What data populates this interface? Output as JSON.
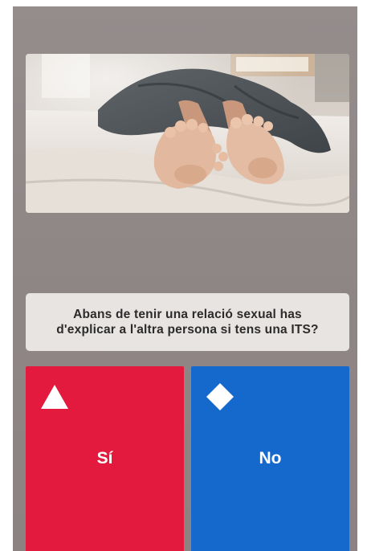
{
  "question": {
    "line1": "Abans de tenir una relació sexual has",
    "line2": "d'explicar a l'altra persona si tens una ITS?"
  },
  "image": {
    "subject": "feet-on-bed-photo"
  },
  "answers": [
    {
      "label": "Sí",
      "shape": "triangle-icon",
      "color": "#e31a3e"
    },
    {
      "label": "No",
      "shape": "diamond-icon",
      "color": "#1568cc"
    }
  ],
  "colors": {
    "background": "#8f8786",
    "question_box": "#e8e4e2"
  }
}
